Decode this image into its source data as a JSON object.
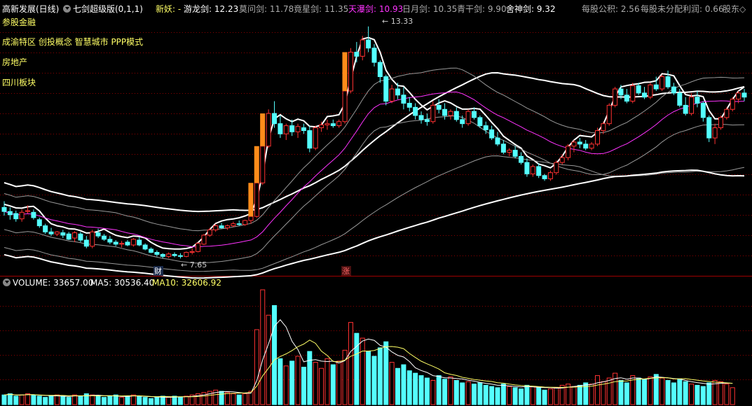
{
  "header": {
    "stock_name": "高新发展(日线)",
    "indicator_icon": "chevron-down-icon",
    "indicator_name": "七剑超级版(0,1,1)",
    "xinyao_label": "新妖: -",
    "swords": [
      {
        "label": "游龙剑: 12.23",
        "color": "#ffffff"
      },
      {
        "label": "莫问剑: 11.78",
        "color": "#aaaaaa"
      },
      {
        "label": "竟星剑: 11.35",
        "color": "#aaaaaa"
      },
      {
        "label": "天瀑剑: 10.93",
        "color": "#ff33ff"
      },
      {
        "label": "日月剑: 10.35",
        "color": "#aaaaaa"
      },
      {
        "label": "青干剑: 9.90",
        "color": "#aaaaaa"
      },
      {
        "label": "舍神剑: 9.32",
        "color": "#ffffff"
      }
    ],
    "right_info": [
      {
        "label": "每股公积: 2.56"
      },
      {
        "label": "每股未分配利润: 0.66"
      },
      {
        "label": "股东◇"
      }
    ]
  },
  "tags": [
    "参股金融",
    "成渝特区 创投概念 智慧城市 PPP模式",
    "房地产",
    "四川板块"
  ],
  "annotations": {
    "high": "13.33",
    "low": "7.65",
    "cai": "财",
    "zhang": "涨"
  },
  "volume_header": {
    "volume": "VOLUME: 33657.00",
    "ma5": "MA5: 30536.40",
    "ma10": "MA10: 32606.92"
  },
  "colors": {
    "up": "#ff3232",
    "down": "#54ffff",
    "bg": "#000000",
    "grid": "#8b0000",
    "ma_pink": "#ff33ff",
    "signal": "#ff8c1a",
    "tag_yellow": "#ffff66"
  },
  "chart_data": {
    "type": "candlestick",
    "title": "高新发展(日线)",
    "price_min": 7.65,
    "price_max": 13.33,
    "candles": [
      [
        8.9,
        9.05,
        8.7,
        8.8
      ],
      [
        8.8,
        8.9,
        8.6,
        8.72
      ],
      [
        8.75,
        8.82,
        8.55,
        8.62
      ],
      [
        8.62,
        8.85,
        8.55,
        8.78
      ],
      [
        8.8,
        8.95,
        8.75,
        8.82
      ],
      [
        8.78,
        8.85,
        8.6,
        8.65
      ],
      [
        8.6,
        8.65,
        8.4,
        8.45
      ],
      [
        8.45,
        8.5,
        8.25,
        8.3
      ],
      [
        8.3,
        8.4,
        8.2,
        8.25
      ],
      [
        8.25,
        8.32,
        8.2,
        8.3
      ],
      [
        8.28,
        8.35,
        8.15,
        8.22
      ],
      [
        8.25,
        8.3,
        8.1,
        8.12
      ],
      [
        8.15,
        8.32,
        8.05,
        8.28
      ],
      [
        8.25,
        8.3,
        8.05,
        8.1
      ],
      [
        8.1,
        8.2,
        7.9,
        7.95
      ],
      [
        7.95,
        8.35,
        7.9,
        8.3
      ],
      [
        8.28,
        8.38,
        8.15,
        8.2
      ],
      [
        8.2,
        8.25,
        8.08,
        8.12
      ],
      [
        8.12,
        8.2,
        8.0,
        8.05
      ],
      [
        8.05,
        8.1,
        7.95,
        8.0
      ],
      [
        8.0,
        8.08,
        7.92,
        8.02
      ],
      [
        8.05,
        8.1,
        7.95,
        7.98
      ],
      [
        7.98,
        8.15,
        7.94,
        8.12
      ],
      [
        8.1,
        8.18,
        7.95,
        7.98
      ],
      [
        7.98,
        8.02,
        7.85,
        7.88
      ],
      [
        7.88,
        7.92,
        7.78,
        7.8
      ],
      [
        7.8,
        7.85,
        7.7,
        7.75
      ],
      [
        7.75,
        7.78,
        7.65,
        7.7
      ],
      [
        7.7,
        7.8,
        7.66,
        7.76
      ],
      [
        7.75,
        7.8,
        7.68,
        7.72
      ],
      [
        7.72,
        7.78,
        7.65,
        7.7
      ],
      [
        7.7,
        7.82,
        7.68,
        7.8
      ],
      [
        7.8,
        7.9,
        7.75,
        7.82
      ],
      [
        7.82,
        8.05,
        7.8,
        8.02
      ],
      [
        8.0,
        8.25,
        7.98,
        8.22
      ],
      [
        8.22,
        8.4,
        8.18,
        8.35
      ],
      [
        8.35,
        8.5,
        8.3,
        8.45
      ],
      [
        8.45,
        8.52,
        8.38,
        8.4
      ],
      [
        8.4,
        8.48,
        8.35,
        8.45
      ],
      [
        8.45,
        8.55,
        8.42,
        8.5
      ],
      [
        8.5,
        8.58,
        8.45,
        8.48
      ],
      [
        8.48,
        8.6,
        8.45,
        8.58
      ],
      [
        8.58,
        8.72,
        8.5,
        8.68
      ],
      [
        8.68,
        9.55,
        8.65,
        9.5
      ],
      [
        9.5,
        10.45,
        9.45,
        10.4
      ],
      [
        10.4,
        11.3,
        10.35,
        11.2
      ],
      [
        11.2,
        11.5,
        10.85,
        10.95
      ],
      [
        10.95,
        11.15,
        10.6,
        10.7
      ],
      [
        10.7,
        10.95,
        10.55,
        10.9
      ],
      [
        10.9,
        11.05,
        10.65,
        10.75
      ],
      [
        10.75,
        10.95,
        10.6,
        10.88
      ],
      [
        10.85,
        10.95,
        10.7,
        10.78
      ],
      [
        10.78,
        10.9,
        10.25,
        10.35
      ],
      [
        10.35,
        10.9,
        10.3,
        10.85
      ],
      [
        10.85,
        11.0,
        10.75,
        10.92
      ],
      [
        10.92,
        11.05,
        10.8,
        10.95
      ],
      [
        10.95,
        11.05,
        10.85,
        10.9
      ],
      [
        10.9,
        11.05,
        10.85,
        11.0
      ],
      [
        11.0,
        11.85,
        10.95,
        11.75
      ],
      [
        11.75,
        12.8,
        11.7,
        12.7
      ],
      [
        12.7,
        12.95,
        12.45,
        12.6
      ],
      [
        12.6,
        13.1,
        12.5,
        13.0
      ],
      [
        13.0,
        13.33,
        12.7,
        12.8
      ],
      [
        12.8,
        12.9,
        12.35,
        12.45
      ],
      [
        12.45,
        12.5,
        11.95,
        12.1
      ],
      [
        12.1,
        12.15,
        11.4,
        11.5
      ],
      [
        11.5,
        11.9,
        11.45,
        11.8
      ],
      [
        11.8,
        11.95,
        11.55,
        11.65
      ],
      [
        11.65,
        11.85,
        11.3,
        11.45
      ],
      [
        11.45,
        11.6,
        11.25,
        11.35
      ],
      [
        11.35,
        11.45,
        11.05,
        11.15
      ],
      [
        11.15,
        11.25,
        10.95,
        11.05
      ],
      [
        11.05,
        11.2,
        10.9,
        11.0
      ],
      [
        11.0,
        11.5,
        10.95,
        11.4
      ],
      [
        11.4,
        11.55,
        11.2,
        11.3
      ],
      [
        11.3,
        11.45,
        11.05,
        11.15
      ],
      [
        11.15,
        11.3,
        11.05,
        11.25
      ],
      [
        11.25,
        11.35,
        11.0,
        11.05
      ],
      [
        11.05,
        11.15,
        10.85,
        10.95
      ],
      [
        10.95,
        11.3,
        10.9,
        11.25
      ],
      [
        11.25,
        11.35,
        11.05,
        11.1
      ],
      [
        11.1,
        11.15,
        10.85,
        10.9
      ],
      [
        10.9,
        11.0,
        10.7,
        10.8
      ],
      [
        10.8,
        10.9,
        10.55,
        10.6
      ],
      [
        10.6,
        10.75,
        10.4,
        10.45
      ],
      [
        10.45,
        10.55,
        10.2,
        10.25
      ],
      [
        10.25,
        10.35,
        10.15,
        10.3
      ],
      [
        10.3,
        10.4,
        10.1,
        10.15
      ],
      [
        10.15,
        10.25,
        9.95,
        10.0
      ],
      [
        10.0,
        10.1,
        9.65,
        9.72
      ],
      [
        9.72,
        9.95,
        9.65,
        9.9
      ],
      [
        9.9,
        9.98,
        9.62,
        9.68
      ],
      [
        9.68,
        9.72,
        9.55,
        9.6
      ],
      [
        9.6,
        9.8,
        9.55,
        9.75
      ],
      [
        9.75,
        10.05,
        9.7,
        10.0
      ],
      [
        10.0,
        10.2,
        9.95,
        10.12
      ],
      [
        10.12,
        10.45,
        10.05,
        10.4
      ],
      [
        10.4,
        10.55,
        10.25,
        10.5
      ],
      [
        10.5,
        10.6,
        10.35,
        10.45
      ],
      [
        10.45,
        10.55,
        10.3,
        10.35
      ],
      [
        10.35,
        10.5,
        10.3,
        10.45
      ],
      [
        10.45,
        10.85,
        10.4,
        10.78
      ],
      [
        10.78,
        11.0,
        10.7,
        10.95
      ],
      [
        10.95,
        11.45,
        10.9,
        11.4
      ],
      [
        11.4,
        11.85,
        11.35,
        11.8
      ],
      [
        11.8,
        11.9,
        11.55,
        11.65
      ],
      [
        11.65,
        11.8,
        11.45,
        11.5
      ],
      [
        11.5,
        11.95,
        11.45,
        11.88
      ],
      [
        11.88,
        11.95,
        11.65,
        11.7
      ],
      [
        11.7,
        11.85,
        11.55,
        11.6
      ],
      [
        11.6,
        11.95,
        11.55,
        11.9
      ],
      [
        11.9,
        12.1,
        11.75,
        11.8
      ],
      [
        11.8,
        12.15,
        11.75,
        12.1
      ],
      [
        12.1,
        12.25,
        11.8,
        11.85
      ],
      [
        11.85,
        11.95,
        11.65,
        11.7
      ],
      [
        11.7,
        11.8,
        11.35,
        11.4
      ],
      [
        11.4,
        11.6,
        11.15,
        11.2
      ],
      [
        11.2,
        11.7,
        11.15,
        11.6
      ],
      [
        11.6,
        11.75,
        11.35,
        11.45
      ],
      [
        11.45,
        11.5,
        11.0,
        11.1
      ],
      [
        11.1,
        11.15,
        10.5,
        10.6
      ],
      [
        10.6,
        10.95,
        10.45,
        10.85
      ],
      [
        10.85,
        11.15,
        10.8,
        11.1
      ],
      [
        11.1,
        11.35,
        11.05,
        11.3
      ],
      [
        11.3,
        11.6,
        11.25,
        11.55
      ],
      [
        11.55,
        11.75,
        11.45,
        11.7
      ],
      [
        11.7,
        11.8,
        11.5,
        11.6
      ]
    ],
    "volume": [
      8,
      9,
      7,
      8,
      9,
      8,
      7,
      6,
      7,
      8,
      7,
      6,
      8,
      7,
      9,
      8,
      7,
      6,
      7,
      8,
      6,
      7,
      8,
      7,
      6,
      5,
      6,
      7,
      6,
      7,
      6,
      7,
      8,
      9,
      10,
      11,
      12,
      11,
      10,
      9,
      8,
      9,
      11,
      62,
      95,
      74,
      82,
      38,
      32,
      36,
      40,
      31,
      44,
      35,
      30,
      38,
      33,
      36,
      45,
      68,
      59,
      55,
      44,
      40,
      47,
      52,
      35,
      30,
      33,
      28,
      26,
      24,
      22,
      20,
      24,
      21,
      23,
      20,
      18,
      19,
      17,
      18,
      16,
      15,
      14,
      17,
      15,
      14,
      13,
      16,
      15,
      14,
      12,
      13,
      14,
      16,
      17,
      15,
      16,
      18,
      17,
      24,
      19,
      22,
      26,
      20,
      18,
      24,
      22,
      21,
      23,
      25,
      22,
      20,
      18,
      21,
      19,
      17,
      16,
      15,
      18,
      20,
      19,
      17,
      14
    ],
    "volume_max": 95
  }
}
